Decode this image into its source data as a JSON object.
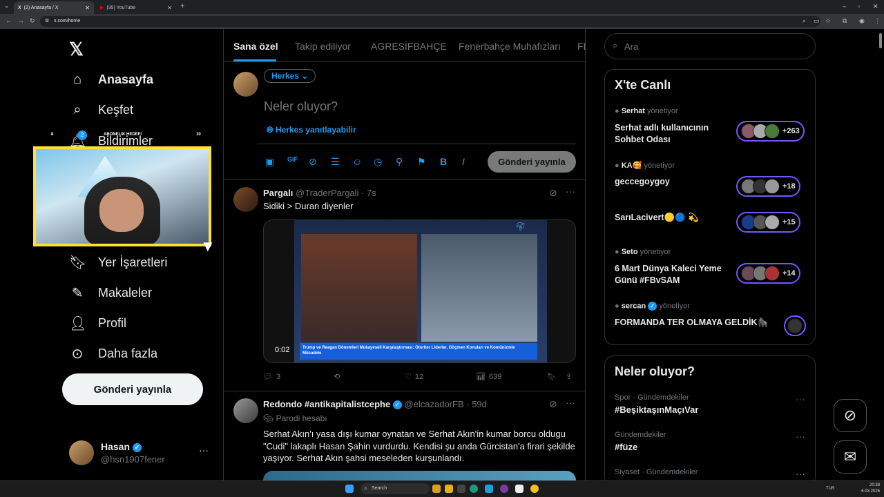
{
  "browser": {
    "tabs": [
      {
        "label": "(2) Anasayfa / X",
        "active": true
      },
      {
        "label": "(95) YouTube",
        "active": false
      }
    ],
    "url": "x.com/home"
  },
  "nav": {
    "items": [
      {
        "label": "Anasayfa",
        "icon": "home-icon"
      },
      {
        "label": "Keşfet",
        "icon": "search-icon"
      },
      {
        "label": "Bildirimler",
        "icon": "bell-icon",
        "badge": "2"
      },
      {
        "label": "Yer İşaretleri",
        "icon": "bookmark-icon"
      },
      {
        "label": "Makaleler",
        "icon": "article-icon"
      },
      {
        "label": "Profil",
        "icon": "profile-icon"
      },
      {
        "label": "Daha fazla",
        "icon": "more-circle-icon"
      }
    ],
    "post_button": "Gönderi yayınla",
    "account": {
      "name": "Hasan",
      "handle": "@hsn1907fener"
    }
  },
  "overlay": {
    "goal_label": "ABONELIK HEDEFI",
    "goal_left": "8",
    "goal_right": "10"
  },
  "feed": {
    "tabs": [
      "Sana özel",
      "Takip ediliyor",
      "AGRESİFBAHÇE",
      "Fenerbahçe Muhafızları",
      "FB"
    ],
    "composer": {
      "audience": "Herkes",
      "placeholder": "Neler oluyor?",
      "reply_setting": "Herkes yanıtlayabilir",
      "post_button": "Gönderi yayınla"
    },
    "tweets": [
      {
        "name": "Pargalı",
        "handle": "@TraderPargali",
        "time": "· 7s",
        "text": "Sidiki > Duran diyenler",
        "video_time": "0:02",
        "video_caption": "Trump ve Reagan Dönemleri Mukayeseli Karşılaştırması: Otoriter Liderler, Göçmen Konuları ve Komünizmle Mücadele",
        "replies": "3",
        "likes": "12",
        "views": "639"
      },
      {
        "name": "Redondo #antikapitalistcephe",
        "handle": "@elcazadorFB",
        "time": "· 59d",
        "label": "Parodi hesabı",
        "text": "Serhat Akın'ı yasa dışı kumar oynatan ve Serhat Akın'in kumar borcu oldugu \"Cudi\" lakaplı Hasan Şahin vurdurdu. Kendisi şu anda Gürcistan'a firari şekilde yaşıyor. Serhat Akın şahsi meseleden kurşunlandı."
      }
    ]
  },
  "sidebar": {
    "search_placeholder": "Ara",
    "live": {
      "title": "X'te Canlı",
      "spaces": [
        {
          "host": "Serhat",
          "suffix": "yönetiyor",
          "title": "Serhat adlı kullanıcının Sohbet Odası",
          "count": "+263"
        },
        {
          "host": "KA🥰",
          "suffix": "yönetiyor",
          "title": "geccegoygoy",
          "count": "+18"
        },
        {
          "host": "",
          "suffix": "",
          "title": "SarıLacivert🟡🔵 💫",
          "count": "+15"
        },
        {
          "host": "Seto",
          "suffix": "yönetiyor",
          "title": "6 Mart Dünya Kaleci Yeme Günü #FBvSAM",
          "count": "+14"
        },
        {
          "host": "sercan",
          "suffix": "yönetiyor",
          "title": "FORMANDA TER OLMAYA GELDİK🦍",
          "count": ""
        }
      ]
    },
    "trends": {
      "title": "Neler oluyor?",
      "items": [
        {
          "meta": "Spor · Gündemdekiler",
          "name": "#BeşiktaşınMaçıVar"
        },
        {
          "meta": "Gündemdekiler",
          "name": "#füze"
        },
        {
          "meta": "Siyaset · Gündemdekiler",
          "name": ""
        }
      ]
    }
  },
  "taskbar": {
    "search": "Search",
    "lang": "TUR",
    "time": "20:38",
    "date": "6.03.2026"
  }
}
